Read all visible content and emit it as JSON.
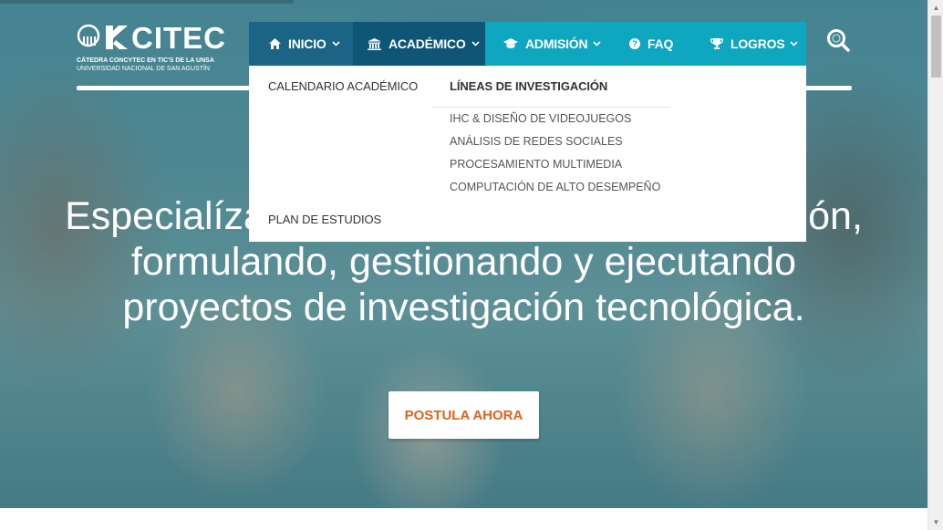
{
  "logo": {
    "word": "CITEC",
    "line1": "CÁTEDRA CONCYTEC EN TIC'S DE LA UNSA",
    "line2": "UNIVERSIDAD NACIONAL DE SAN AGUSTÍN"
  },
  "nav": {
    "items": [
      {
        "label": "INICIO",
        "icon": "home-icon"
      },
      {
        "label": "ACADÉMICO",
        "icon": "university-icon"
      },
      {
        "label": "ADMISIÓN",
        "icon": "graduation-cap-icon"
      },
      {
        "label": "FAQ",
        "icon": "question-circle-icon"
      },
      {
        "label": "LOGROS",
        "icon": "trophy-icon"
      }
    ],
    "active": "ACADÉMICO"
  },
  "dropdown": {
    "calendario": "CALENDARIO ACADÉMICO",
    "lineas_title": "LÍNEAS DE INVESTIGACIÓN",
    "lineas": [
      "IHC & DISEÑO DE VIDEOJUEGOS",
      "ANÁLISIS DE REDES SOCIALES",
      "PROCESAMIENTO MULTIMEDIA",
      "COMPUTACIÓN DE ALTO DESEMPEÑO"
    ],
    "plan": "PLAN DE ESTUDIOS"
  },
  "hero": {
    "line1": "Especialízate en Ciencias de la Computación,",
    "line2": "formulando, gestionando y ejecutando",
    "line3": "proyectos de investigación tecnológica.",
    "cta": "POSTULA AHORA"
  },
  "colors": {
    "nav_dark": "#0e5576",
    "nav_mid": "#1b6486",
    "nav_light": "#0fa6bf",
    "cta_text": "#e0621b"
  }
}
